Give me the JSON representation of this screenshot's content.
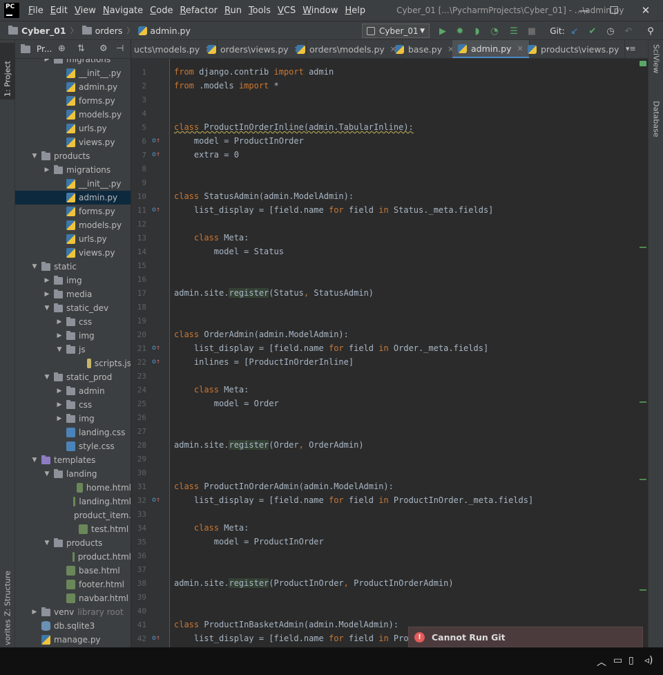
{
  "app": {
    "logo": "PC",
    "menu": [
      "File",
      "Edit",
      "View",
      "Navigate",
      "Code",
      "Refactor",
      "Run",
      "Tools",
      "VCS",
      "Window",
      "Help"
    ],
    "window_title": "Cyber_01 [...\\PycharmProjects\\Cyber_01] - ...\\admin.py",
    "controls": [
      "—",
      "☐",
      "✕"
    ]
  },
  "breadcrumb": [
    "Cyber_01",
    "orders",
    "admin.py"
  ],
  "toolbar": {
    "run_config": "Cyber_01",
    "git_label": "Git:"
  },
  "left_strip": {
    "project_tab": "1: Project",
    "structure_tab": "Z: Structure",
    "favorites_tab": "vorites"
  },
  "project_panel": {
    "title": "Pr..."
  },
  "tree": [
    {
      "label": "migrations",
      "indent": 2,
      "icon": "folder",
      "arrow": "right"
    },
    {
      "label": "__init__.py",
      "indent": 3,
      "icon": "py",
      "arrow": ""
    },
    {
      "label": "admin.py",
      "indent": 3,
      "icon": "py",
      "arrow": ""
    },
    {
      "label": "forms.py",
      "indent": 3,
      "icon": "py",
      "arrow": ""
    },
    {
      "label": "models.py",
      "indent": 3,
      "icon": "py",
      "arrow": ""
    },
    {
      "label": "urls.py",
      "indent": 3,
      "icon": "py",
      "arrow": ""
    },
    {
      "label": "views.py",
      "indent": 3,
      "icon": "py",
      "arrow": ""
    },
    {
      "label": "products",
      "indent": 1,
      "icon": "folder",
      "arrow": "down"
    },
    {
      "label": "migrations",
      "indent": 2,
      "icon": "folder",
      "arrow": "right"
    },
    {
      "label": "__init__.py",
      "indent": 3,
      "icon": "py",
      "arrow": ""
    },
    {
      "label": "admin.py",
      "indent": 3,
      "icon": "py",
      "arrow": "",
      "selected": true
    },
    {
      "label": "forms.py",
      "indent": 3,
      "icon": "py",
      "arrow": ""
    },
    {
      "label": "models.py",
      "indent": 3,
      "icon": "py",
      "arrow": ""
    },
    {
      "label": "urls.py",
      "indent": 3,
      "icon": "py",
      "arrow": ""
    },
    {
      "label": "views.py",
      "indent": 3,
      "icon": "py",
      "arrow": ""
    },
    {
      "label": "static",
      "indent": 1,
      "icon": "folder",
      "arrow": "down"
    },
    {
      "label": "img",
      "indent": 2,
      "icon": "folder",
      "arrow": "right"
    },
    {
      "label": "media",
      "indent": 2,
      "icon": "folder",
      "arrow": "right"
    },
    {
      "label": "static_dev",
      "indent": 2,
      "icon": "folder",
      "arrow": "down"
    },
    {
      "label": "css",
      "indent": 3,
      "icon": "folder",
      "arrow": "right"
    },
    {
      "label": "img",
      "indent": 3,
      "icon": "folder",
      "arrow": "right"
    },
    {
      "label": "js",
      "indent": 3,
      "icon": "folder",
      "arrow": "down"
    },
    {
      "label": "scripts.js",
      "indent": 5,
      "icon": "js",
      "arrow": ""
    },
    {
      "label": "static_prod",
      "indent": 2,
      "icon": "folder",
      "arrow": "down"
    },
    {
      "label": "admin",
      "indent": 3,
      "icon": "folder",
      "arrow": "right"
    },
    {
      "label": "css",
      "indent": 3,
      "icon": "folder",
      "arrow": "right"
    },
    {
      "label": "img",
      "indent": 3,
      "icon": "folder",
      "arrow": "right"
    },
    {
      "label": "landing.css",
      "indent": 3,
      "icon": "css",
      "arrow": ""
    },
    {
      "label": "style.css",
      "indent": 3,
      "icon": "css",
      "arrow": ""
    },
    {
      "label": "templates",
      "indent": 1,
      "icon": "folder-purple",
      "arrow": "down"
    },
    {
      "label": "landing",
      "indent": 2,
      "icon": "folder",
      "arrow": "down"
    },
    {
      "label": "home.html",
      "indent": 4,
      "icon": "html",
      "arrow": ""
    },
    {
      "label": "landing.html",
      "indent": 4,
      "icon": "html",
      "arrow": ""
    },
    {
      "label": "product_item.",
      "indent": 4,
      "icon": "html",
      "arrow": ""
    },
    {
      "label": "test.html",
      "indent": 4,
      "icon": "html",
      "arrow": ""
    },
    {
      "label": "products",
      "indent": 2,
      "icon": "folder",
      "arrow": "down"
    },
    {
      "label": "product.html",
      "indent": 4,
      "icon": "html",
      "arrow": ""
    },
    {
      "label": "base.html",
      "indent": 3,
      "icon": "html",
      "arrow": ""
    },
    {
      "label": "footer.html",
      "indent": 3,
      "icon": "html",
      "arrow": ""
    },
    {
      "label": "navbar.html",
      "indent": 3,
      "icon": "html",
      "arrow": ""
    },
    {
      "label": "venv",
      "indent": 1,
      "icon": "folder",
      "arrow": "right",
      "lib": "library root"
    },
    {
      "label": "db.sqlite3",
      "indent": 1,
      "icon": "db",
      "arrow": ""
    },
    {
      "label": "manage.py",
      "indent": 1,
      "icon": "py",
      "arrow": ""
    }
  ],
  "tabs": [
    {
      "label": "ucts\\models.py",
      "active": false
    },
    {
      "label": "orders\\views.py",
      "active": false
    },
    {
      "label": "orders\\models.py",
      "active": false
    },
    {
      "label": "base.py",
      "active": false
    },
    {
      "label": "admin.py",
      "active": true
    },
    {
      "label": "products\\views.py",
      "active": false
    }
  ],
  "tabs_overflow": "▾≡",
  "code_lines": [
    "from django.contrib import admin",
    "from .models import *",
    "",
    "",
    "class ProductInOrderInline(admin.TabularInline):",
    "    model = ProductInOrder",
    "    extra = 0",
    "",
    "",
    "class StatusAdmin(admin.ModelAdmin):",
    "    list_display = [field.name for field in Status._meta.fields]",
    "",
    "    class Meta:",
    "        model = Status",
    "",
    "",
    "admin.site.register(Status, StatusAdmin)",
    "",
    "",
    "class OrderAdmin(admin.ModelAdmin):",
    "    list_display = [field.name for field in Order._meta.fields]",
    "    inlines = [ProductInOrderInline]",
    "",
    "    class Meta:",
    "        model = Order",
    "",
    "",
    "admin.site.register(Order, OrderAdmin)",
    "",
    "",
    "class ProductInOrderAdmin(admin.ModelAdmin):",
    "    list_display = [field.name for field in ProductInOrder._meta.fields]",
    "",
    "    class Meta:",
    "        model = ProductInOrder",
    "",
    "",
    "admin.site.register(ProductInOrder, ProductInOrderAdmin)",
    "",
    "",
    "class ProductInBasketAdmin(admin.ModelAdmin):",
    "    list_display = [field.name for field in ProductInBasket._meta.fields]",
    ""
  ],
  "right_strip": {
    "sciview": "SciView",
    "database": "Database"
  },
  "notification": {
    "text": "Cannot Run Git"
  },
  "taskbar": {
    "tray_icons": [
      "chevron-up-icon",
      "battery-icon",
      "network-icon",
      "volume-icon"
    ]
  }
}
